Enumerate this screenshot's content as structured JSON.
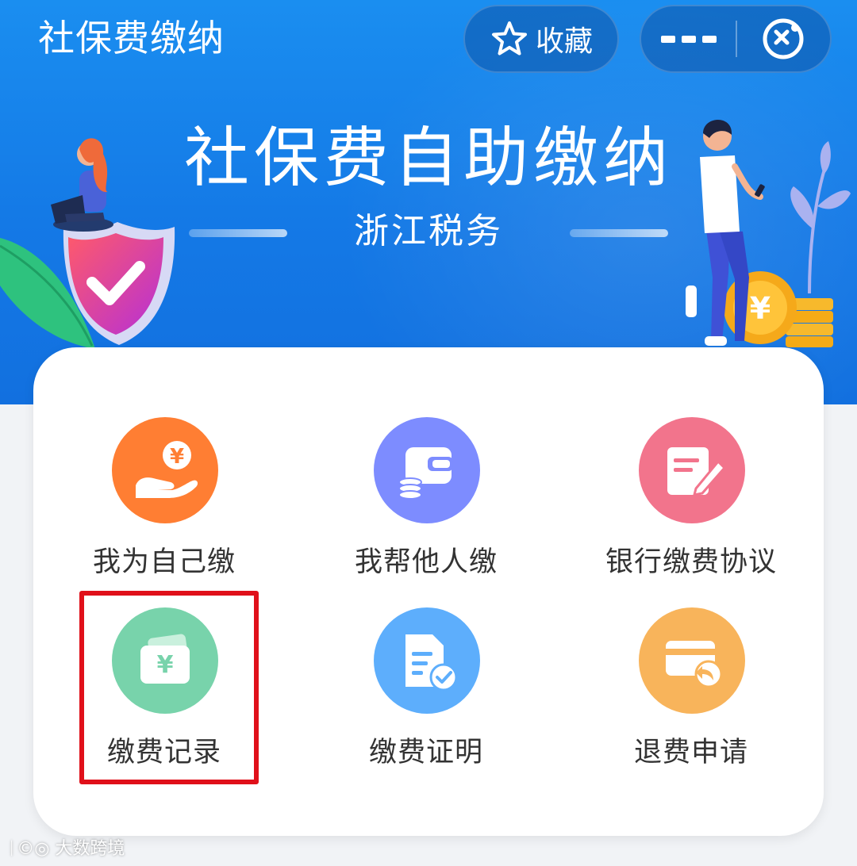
{
  "header": {
    "title": "社保费缴纳",
    "favorite_label": "收藏"
  },
  "banner": {
    "title": "社保费自助缴纳",
    "subtitle": "浙江税务"
  },
  "menu": {
    "items": [
      {
        "label": "我为自己缴",
        "icon": "hand-coin-icon",
        "color": "#ff7e33"
      },
      {
        "label": "我帮他人缴",
        "icon": "wallet-icon",
        "color": "#7d8cff"
      },
      {
        "label": "银行缴费协议",
        "icon": "document-pen-icon",
        "color": "#f2748c"
      },
      {
        "label": "缴费记录",
        "icon": "yuan-card-icon",
        "color": "#78d3ab"
      },
      {
        "label": "缴费证明",
        "icon": "document-check-icon",
        "color": "#5daefc"
      },
      {
        "label": "退费申请",
        "icon": "card-return-icon",
        "color": "#f8b45b"
      }
    ],
    "highlighted_item": "缴费记录"
  },
  "colors": {
    "banner_blue": "#1a8ef0",
    "highlight_red": "#e0101a"
  }
}
